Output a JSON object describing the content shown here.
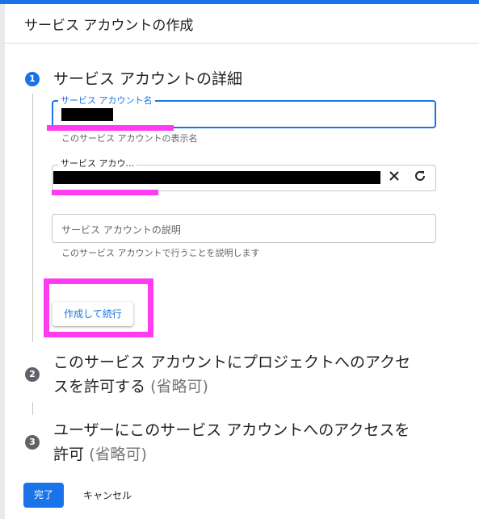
{
  "header": {
    "title": "サービス アカウントの作成"
  },
  "steps": [
    {
      "number": "1",
      "title": "サービス アカウントの詳細"
    },
    {
      "number": "2",
      "title_line1": "このサービス アカウントにプロジェクトへのアクセ",
      "title_line2": "スを許可する",
      "optional": "(省略可)"
    },
    {
      "number": "3",
      "title_line1": "ユーザーにこのサービス アカウントへのアクセスを",
      "title_line2": "許可",
      "optional": "(省略可)"
    }
  ],
  "form": {
    "account_name": {
      "label": "サービス アカウント名",
      "hint": "このサービス アカウントの表示名"
    },
    "account_id": {
      "label": "サービス アカウ...",
      "clear_icon": "close-icon",
      "refresh_icon": "refresh-icon"
    },
    "description": {
      "placeholder": "サービス アカウントの説明",
      "hint": "このサービス アカウントで行うことを説明します"
    },
    "continue_label": "作成して続行"
  },
  "footer": {
    "done_label": "完了",
    "cancel_label": "キャンセル"
  },
  "colors": {
    "accent": "#1a73e8",
    "annotation": "#ff3cf0",
    "step_inactive": "#5f6368"
  }
}
